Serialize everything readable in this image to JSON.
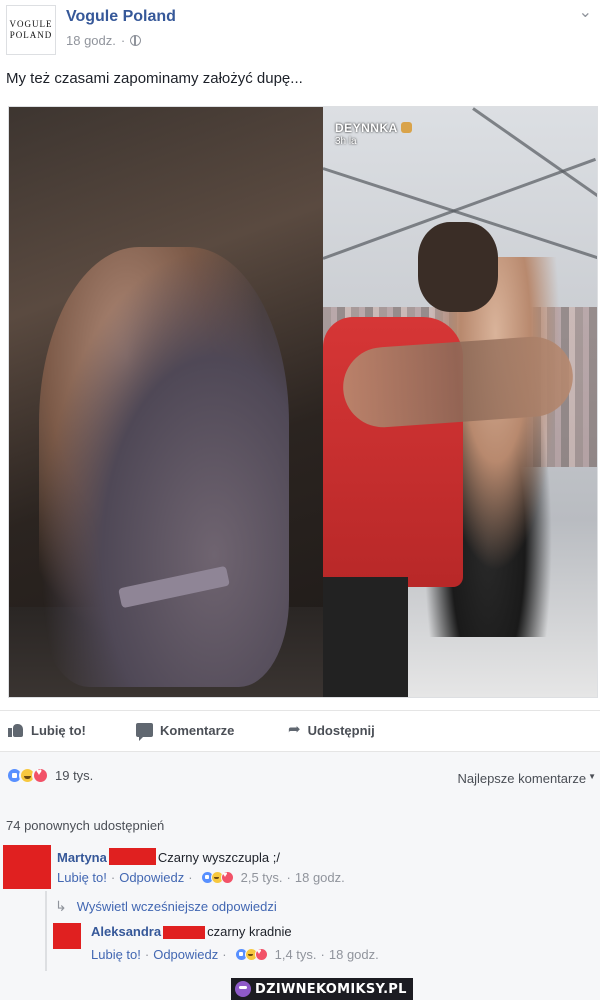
{
  "post": {
    "page_name": "Vogule Poland",
    "logo_line1": "VOGULE",
    "logo_line2": "POLAND",
    "time": "18 godz.",
    "separator": "·",
    "options_glyph": "⌄",
    "text": "My też czasami zapominamy założyć dupę...",
    "snap": {
      "name": "DEYNNKA",
      "time": "3h la"
    }
  },
  "actions": {
    "like": "Lubię to!",
    "comment": "Komentarze",
    "share": "Udostępnij",
    "icons": [
      "thumbs-up-icon",
      "comment-icon",
      "share-arrow-icon"
    ]
  },
  "reactions": {
    "count": "19 tys.",
    "sort_label": "Najlepsze komentarze",
    "types": [
      "like",
      "haha",
      "love"
    ]
  },
  "comments": {
    "shares": "74 ponownych udostępnień",
    "items": [
      {
        "name": "Martyna",
        "text": "Czarny wyszczupla ;/",
        "like": "Lubię to!",
        "reply": "Odpowiedz",
        "reactions": "2,5 tys.",
        "time": "18 godz."
      },
      {
        "name": "Aleksandra",
        "text": "czarny kradnie",
        "like": "Lubię to!",
        "reply": "Odpowiedz",
        "reactions": "1,4 tys.",
        "time": "18 godz."
      }
    ],
    "view_replies": "Wyświetl wcześniejsze odpowiedzi"
  },
  "watermark": "DZIWNEKOMIKSY.PL",
  "colors": {
    "link": "#365899",
    "redaction": "#e02020",
    "like": "#5890ff",
    "haha": "#f7c83f",
    "love": "#f25268"
  }
}
